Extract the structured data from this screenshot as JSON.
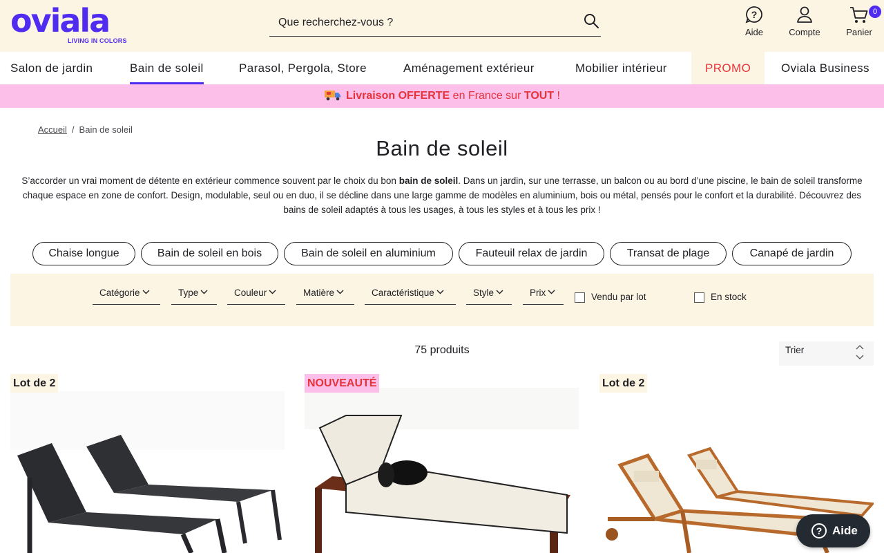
{
  "header": {
    "logo_text": "oviala",
    "logo_tagline": "LIVING IN COLORS",
    "search_placeholder": "Que recherchez-vous ?",
    "help_label": "Aide",
    "account_label": "Compte",
    "cart_label": "Panier",
    "cart_count": "0"
  },
  "nav": {
    "items": [
      {
        "label": "Salon de jardin"
      },
      {
        "label": "Bain de soleil"
      },
      {
        "label": "Parasol, Pergola, Store"
      },
      {
        "label": "Aménagement extérieur"
      },
      {
        "label": "Mobilier intérieur"
      },
      {
        "label": "PROMO"
      },
      {
        "label": "Oviala Business"
      }
    ],
    "active_index": 1
  },
  "banner": {
    "part1": "Livraison OFFERTE",
    "part2": " en France sur ",
    "part3": "TOUT",
    "part4": " !"
  },
  "breadcrumb": {
    "home": "Accueil",
    "separator": "/",
    "current": "Bain de soleil"
  },
  "page": {
    "title": "Bain de soleil",
    "intro_before": "S’accorder un vrai moment de détente en extérieur commence souvent par le choix du bon ",
    "intro_bold": "bain de soleil",
    "intro_after": ". Dans un jardin, sur une terrasse, un balcon ou au bord d’une piscine, le bain de soleil transforme chaque espace en zone de confort. Design, modulable, seul ou en duo, il se décline dans une large gamme de modèles en aluminium, bois ou métal, pensés pour le confort et la durabilité. Découvrez des bains de soleil adaptés à tous les usages, à tous les styles et à tous les prix !"
  },
  "chips": [
    {
      "label": "Chaise longue"
    },
    {
      "label": "Bain de soleil en bois"
    },
    {
      "label": "Bain de soleil en aluminium"
    },
    {
      "label": "Fauteuil relax de jardin"
    },
    {
      "label": "Transat de plage"
    },
    {
      "label": "Canapé de jardin"
    }
  ],
  "filters": [
    {
      "label": "Catégorie"
    },
    {
      "label": "Type"
    },
    {
      "label": "Couleur"
    },
    {
      "label": "Matière"
    },
    {
      "label": "Caractéristique"
    },
    {
      "label": "Style"
    },
    {
      "label": "Prix"
    }
  ],
  "checkboxes": [
    {
      "label": "Vendu par lot",
      "checked": false
    },
    {
      "label": "En stock",
      "checked": false
    }
  ],
  "results": {
    "count_label": "75 produits",
    "sort_label": "Trier"
  },
  "products": [
    {
      "badge": "Lot de 2",
      "image": "two-black-aluminium-sun-loungers"
    },
    {
      "badge": "NOUVEAUTÉ",
      "image": "wooden-sun-lounger-with-white-cushion"
    },
    {
      "badge": "Lot de 2",
      "image": "two-wooden-sun-loungers-beige-fabric"
    }
  ],
  "help_widget": {
    "label": "Aide"
  },
  "colors": {
    "brand": "#4f2cf0",
    "header_bg": "#fdf5e4",
    "banner_bg": "#fbbfe9",
    "promo_red": "#e5333b"
  }
}
